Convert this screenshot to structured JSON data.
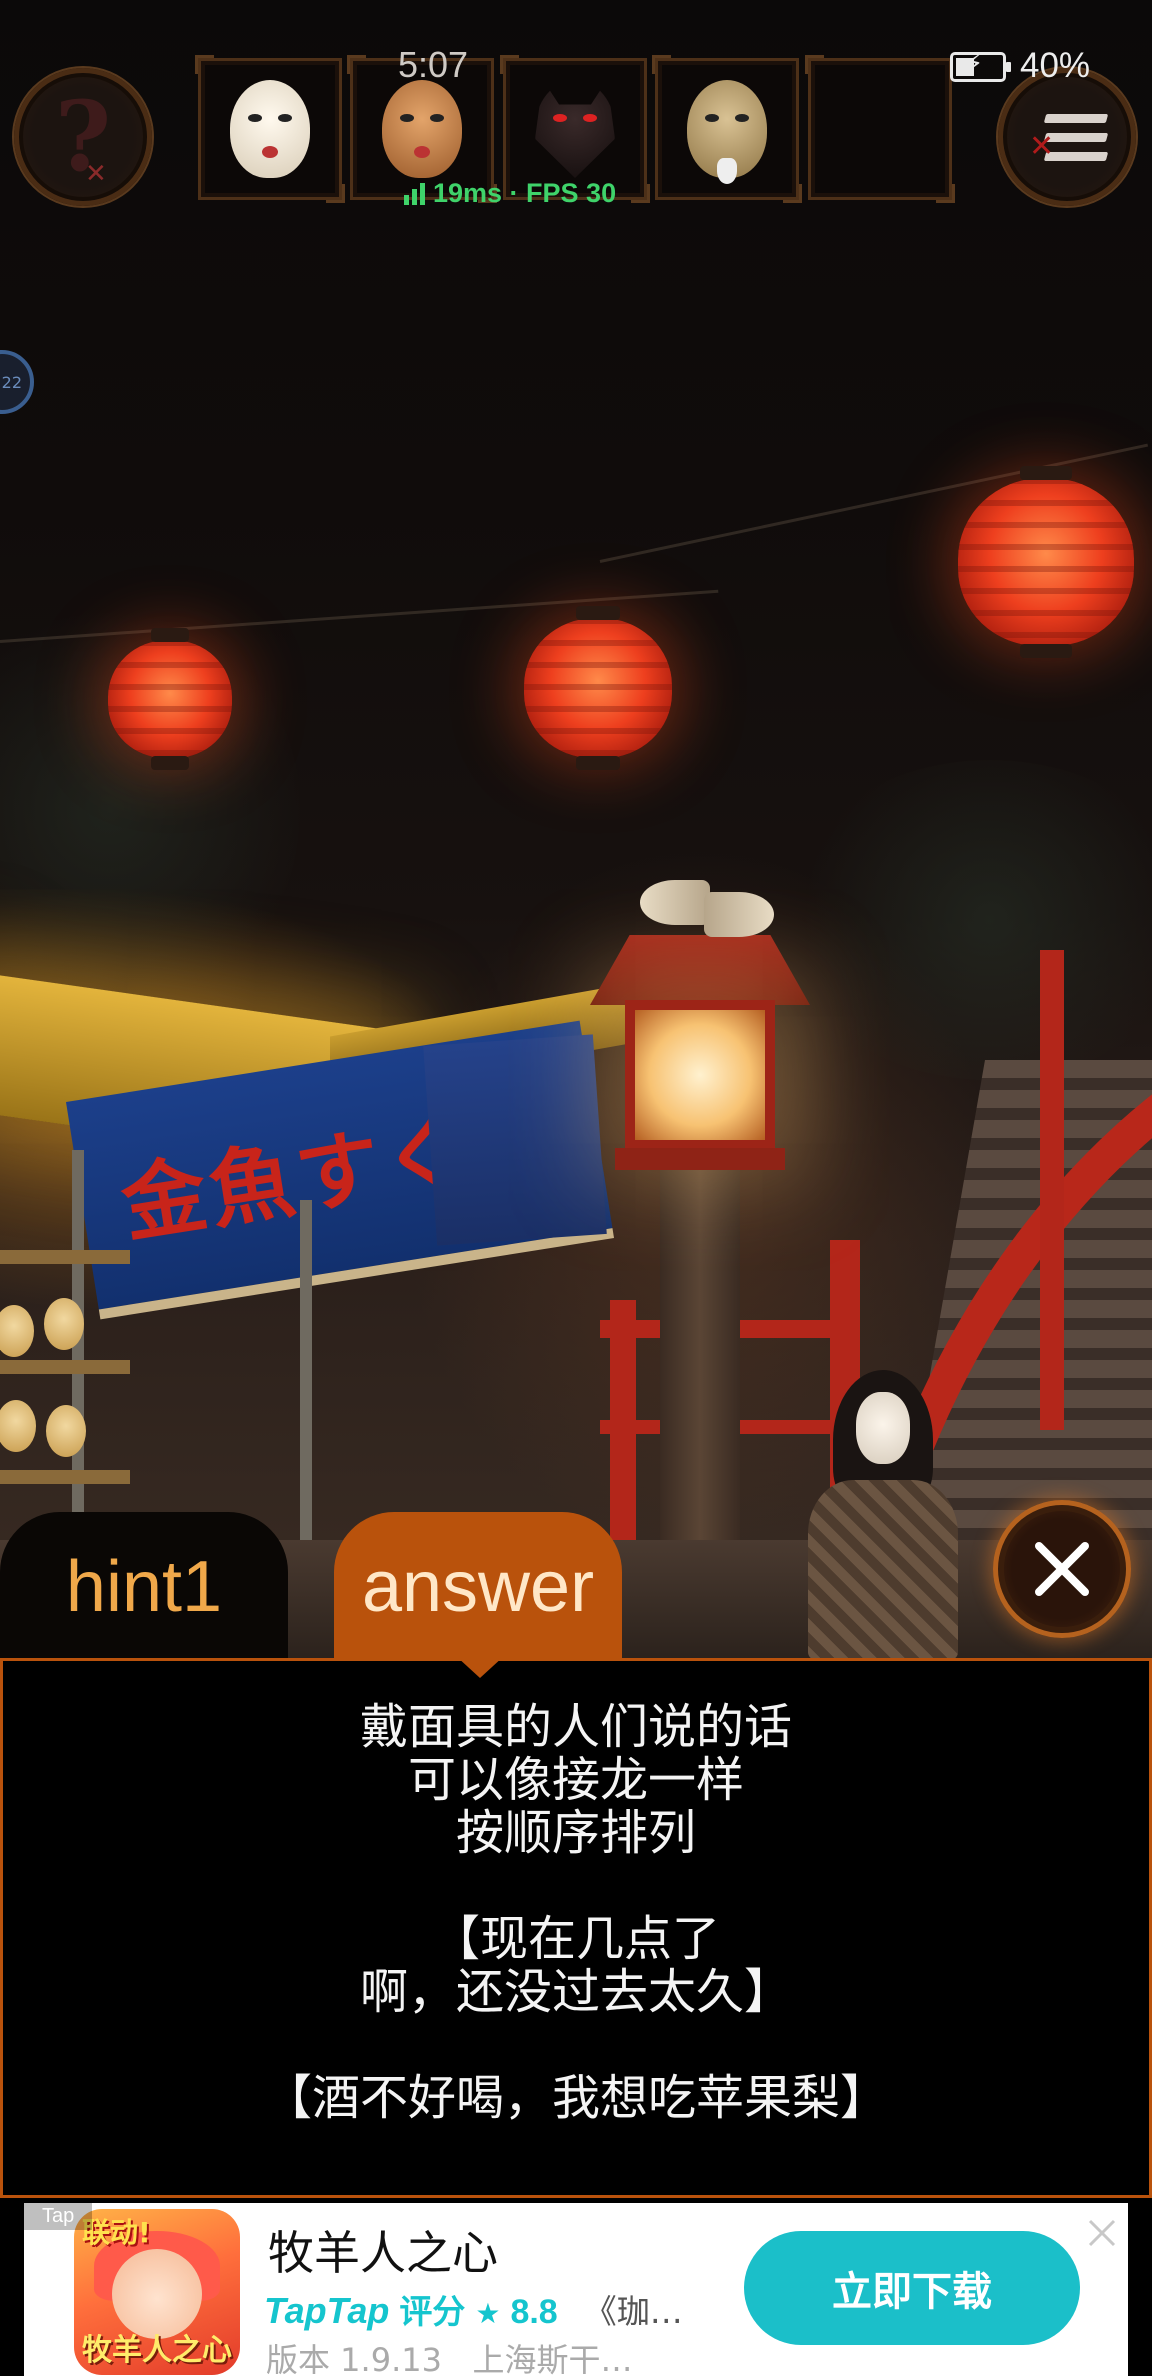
{
  "status_bar": {
    "time": "5:07",
    "battery_pct": "40%",
    "net_info": "19ms · FPS 30"
  },
  "hud": {
    "help_icon": "question-icon",
    "menu_icon": "menu-icon",
    "inventory": [
      {
        "item": "okame-mask-icon"
      },
      {
        "item": "hyottoko-mask-icon"
      },
      {
        "item": "kitsune-mask-icon"
      },
      {
        "item": "okina-mask-icon"
      },
      {
        "item": ""
      }
    ],
    "float_ball_label": "22"
  },
  "scene": {
    "banner_text": "金魚すくい"
  },
  "hint_panel": {
    "tabs": [
      {
        "label": "hint1",
        "active": false
      },
      {
        "label": "answer",
        "active": true
      }
    ],
    "lines": [
      "戴面具的人们说的话",
      "可以像接龙一样",
      "按顺序排列",
      "",
      "【现在几点了",
      "啊，还没过去太久】",
      "",
      "【酒不好喝，我想吃苹果梨】"
    ],
    "colors": {
      "accent": "#b9520c",
      "inactive_tab_text": "#f0a84a"
    }
  },
  "ad": {
    "tag": "Tap",
    "icon_badge": "联动!",
    "icon_title": "牧羊人之心",
    "title": "牧羊人之心",
    "rating_brand": "TapTap",
    "rating_label": "评分",
    "rating_value": "8.8",
    "description": "《珈…",
    "version": "版本 1.9.13",
    "publisher": "上海斯干…",
    "download_label": "立即下载",
    "colors": {
      "brand": "#15c5ce",
      "button": "#1bbfc9"
    }
  }
}
